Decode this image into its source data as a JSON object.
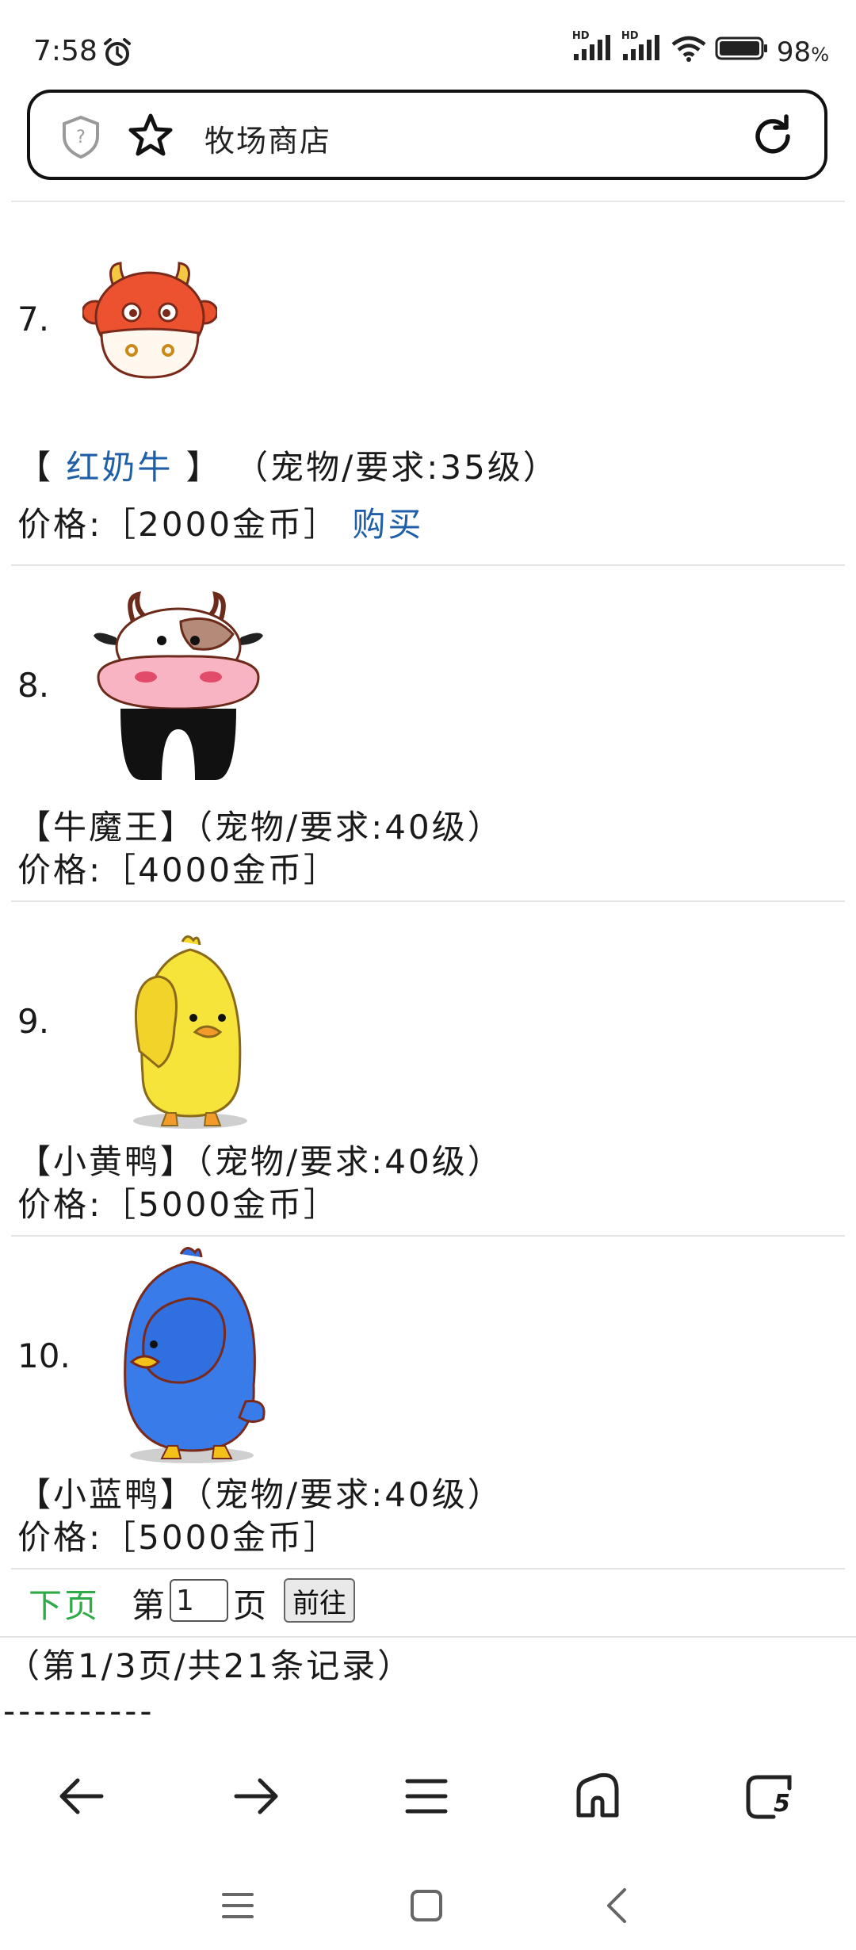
{
  "status_bar": {
    "time": "7:58",
    "signal1_label": "HD",
    "signal2_label": "HD",
    "battery": "98",
    "battery_unit": "%"
  },
  "url_bar": {
    "title": "牧场商店"
  },
  "items": [
    {
      "number": "7.",
      "name_open": "【 ",
      "name": "红奶牛",
      "name_close": " 】",
      "desc": "（宠物/要求:35级）",
      "price": "价格:［2000金币］",
      "buy": "购买",
      "image_icon": "red-cow-icon"
    },
    {
      "number": "8.",
      "name_line": "【牛魔王】（宠物/要求:40级）",
      "price": "价格:［4000金币］",
      "image_icon": "cow-king-icon"
    },
    {
      "number": "9.",
      "name_line": "【小黄鸭】（宠物/要求:40级）",
      "price": "价格:［5000金币］",
      "image_icon": "yellow-duck-icon"
    },
    {
      "number": "10.",
      "name_line": "【小蓝鸭】（宠物/要求:40级）",
      "price": "价格:［5000金币］",
      "image_icon": "blue-duck-icon"
    }
  ],
  "pager": {
    "next": "下页",
    "page_prefix": "第",
    "page_value": "1",
    "page_suffix": "页",
    "go": "前往"
  },
  "record": "（第1/3页/共21条记录）",
  "separator": "----------",
  "bottom_nav": {
    "tabs_count": "5"
  },
  "colors": {
    "link": "#1f5fa8",
    "next_link": "#2eaa46"
  }
}
